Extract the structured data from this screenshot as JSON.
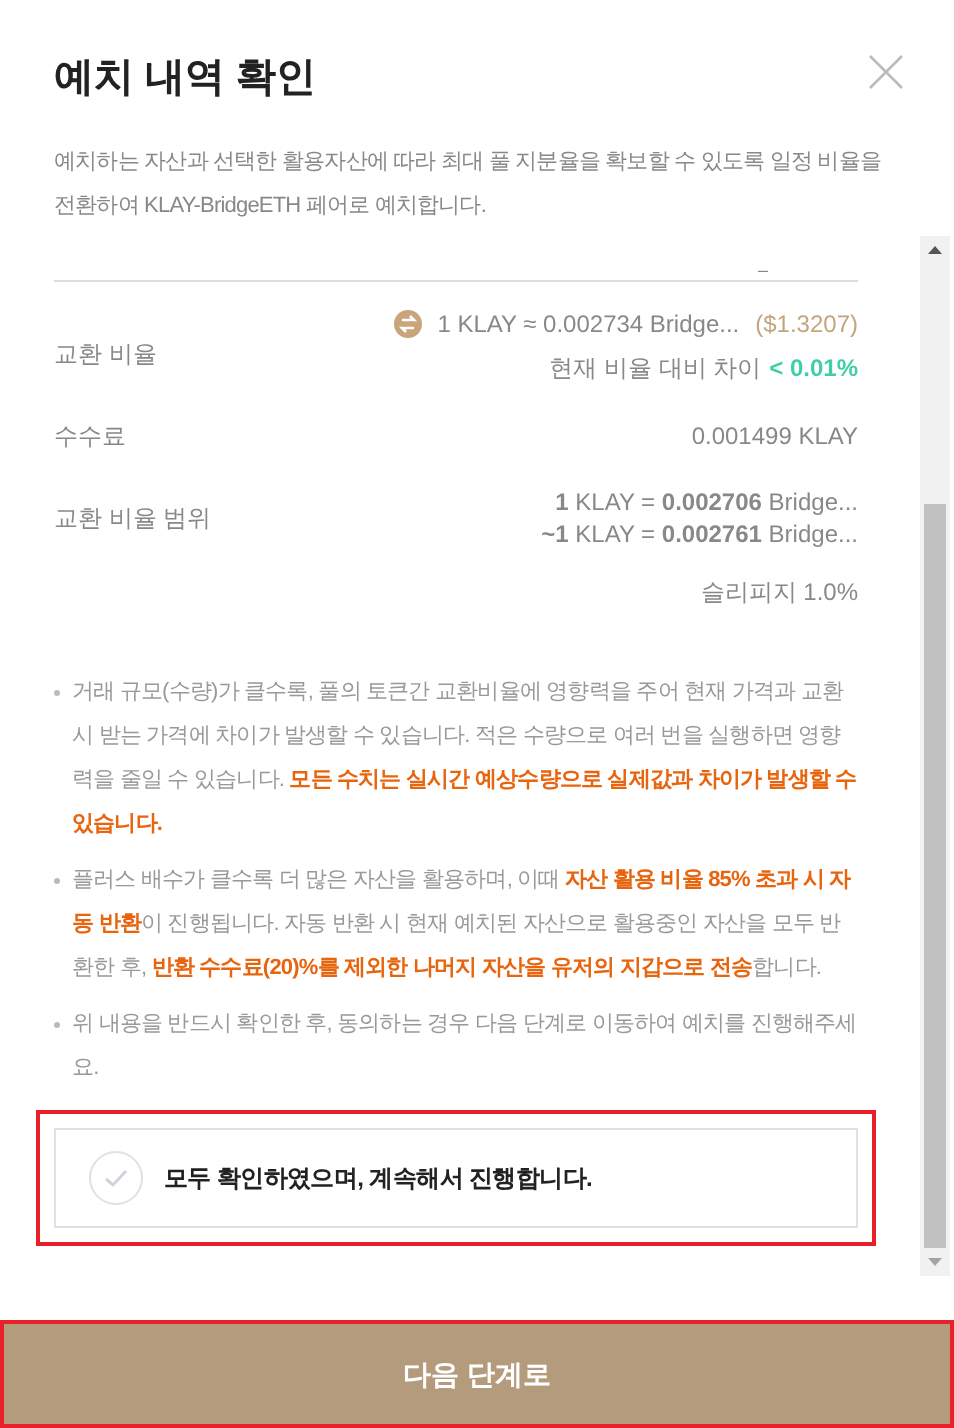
{
  "dialog": {
    "title": "예치 내역 확인",
    "description": "예치하는 자산과 선택한 활용자산에 따라 최대 풀 지분율을 확보할 수 있도록 일정 비율을 전환하여 KLAY-BridgeETH 페어로 예치합니다."
  },
  "cut_text": "–",
  "details": [
    {
      "kind": "rate",
      "label": "교환 비율",
      "rate": "1 KLAY ≈ 0.002734 Bridge...",
      "usd": "($1.3207)",
      "diff_label": "현재 비율 대비 차이",
      "diff_value": "< 0.01%"
    },
    {
      "kind": "plain",
      "label": "수수료",
      "value": "0.001499 KLAY"
    },
    {
      "kind": "range",
      "label": "교환 비율 범위",
      "lines": [
        "**1** KLAY = **0.002706** Bridge...",
        "**~1** KLAY = **0.002761** Bridge..."
      ],
      "note": "슬리피지 1.0%"
    }
  ],
  "notices": [
    "거래 규모(수량)가 클수록, 풀의 토큰간 교환비율에 영향력을 주어 현재 가격과 교환 시 받는 가격에 차이가 발생할 수 있습니다. 적은 수량으로 여러 번을 실행하면 영향력을 줄일 수 있습니다. **모든 수치는 실시간 예상수량으로 실제값과 차이가 발생할 수 있습니다.**",
    "플러스 배수가 클수록 더 많은 자산을 활용하며, 이때 **자산 활용 비율 85% 초과 시 자동 반환**이 진행됩니다. 자동 반환 시 현재 예치된 자산으로 활용중인 자산을 모두 반환한 후, **반환 수수료(20)%를 제외한 나머지 자산을 유저의 지갑으로 전송**합니다.",
    "위 내용을 반드시 확인한 후, 동의하는 경우 다음 단계로 이동하여 예치를 진행해주세요."
  ],
  "confirm": {
    "label": "모두 확인하였으며, 계속해서 진행합니다.",
    "checked": false
  },
  "next_button": "다음 단계로"
}
